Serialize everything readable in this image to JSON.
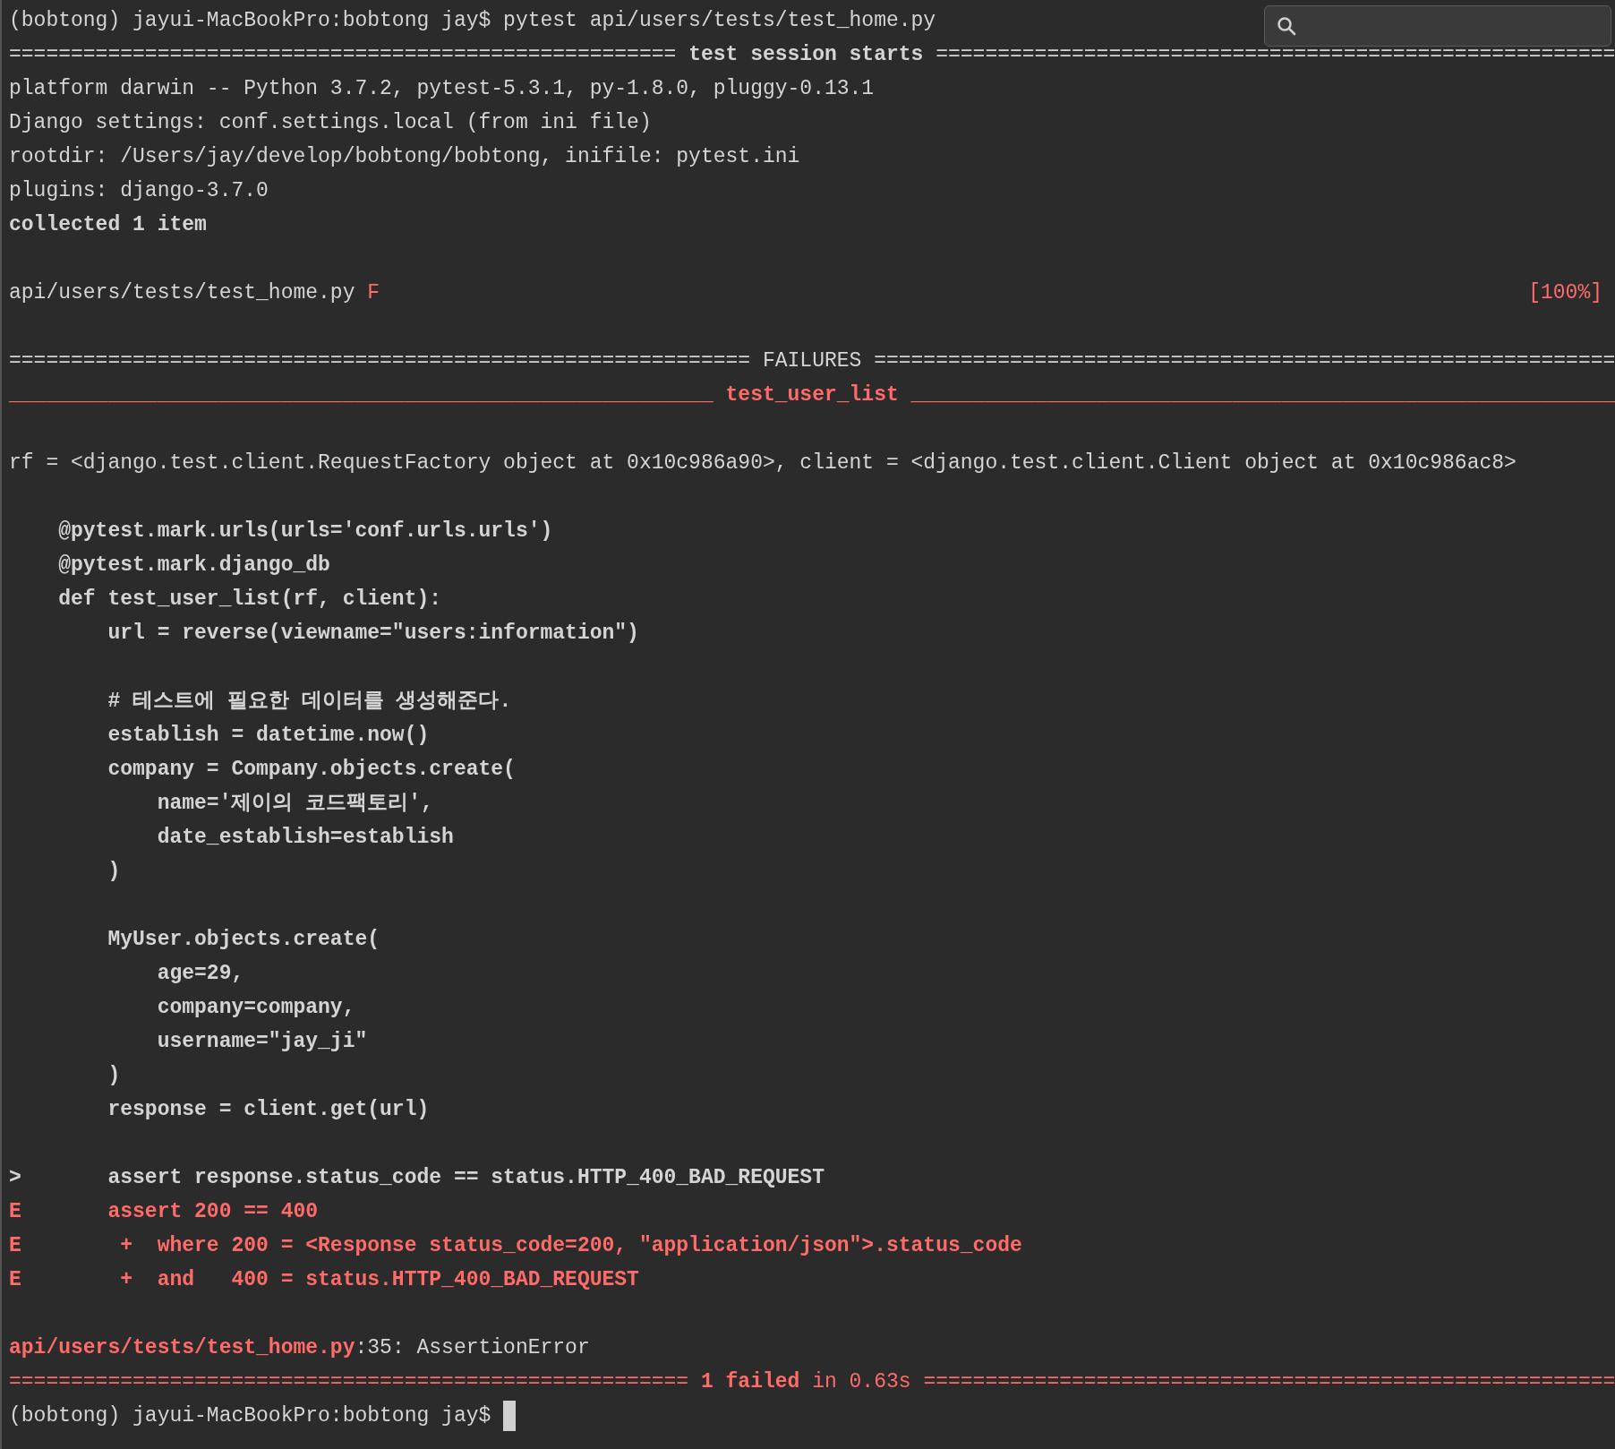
{
  "terminal": {
    "lines": [
      {
        "kind": "text",
        "segments": [
          {
            "text": "(bobtong) jayui-MacBookPro:bobtong jay$ pytest api/users/tests/test_home.py",
            "kind": "plain"
          }
        ]
      },
      {
        "kind": "text",
        "segments": [
          {
            "text": "====================================================== ",
            "kind": "plain"
          },
          {
            "text": "test session starts",
            "kind": "bold"
          },
          {
            "text": " =======================================================",
            "kind": "plain"
          }
        ]
      },
      {
        "kind": "text",
        "segments": [
          {
            "text": "platform darwin -- Python 3.7.2, pytest-5.3.1, py-1.8.0, pluggy-0.13.1",
            "kind": "plain"
          }
        ]
      },
      {
        "kind": "text",
        "segments": [
          {
            "text": "Django settings: conf.settings.local (from ini file)",
            "kind": "plain"
          }
        ]
      },
      {
        "kind": "text",
        "segments": [
          {
            "text": "rootdir: /Users/jay/develop/bobtong/bobtong, inifile: pytest.ini",
            "kind": "plain"
          }
        ]
      },
      {
        "kind": "text",
        "segments": [
          {
            "text": "plugins: django-3.7.0",
            "kind": "plain"
          }
        ]
      },
      {
        "kind": "text",
        "segments": [
          {
            "text": "collected 1 item",
            "kind": "bold"
          }
        ]
      },
      {
        "kind": "blank"
      },
      {
        "kind": "text",
        "segments": [
          {
            "text": "api/users/tests/test_home.py ",
            "kind": "plain"
          },
          {
            "text": "F",
            "kind": "red"
          }
        ],
        "right": {
          "text": "[100%]",
          "kind": "red"
        }
      },
      {
        "kind": "blank"
      },
      {
        "kind": "text",
        "segments": [
          {
            "text": "============================================================ FAILURES ============================================================",
            "kind": "plain"
          }
        ]
      },
      {
        "kind": "text",
        "segments": [
          {
            "text": "_________________________________________________________ ",
            "kind": "red"
          },
          {
            "text": "test_user_list",
            "kind": "red_bold"
          },
          {
            "text": " _________________________________________________________",
            "kind": "red"
          }
        ]
      },
      {
        "kind": "blank"
      },
      {
        "kind": "text",
        "segments": [
          {
            "text": "rf = <django.test.client.RequestFactory object at 0x10c986a90>, client = <django.test.client.Client object at 0x10c986ac8>",
            "kind": "plain"
          }
        ]
      },
      {
        "kind": "blank"
      },
      {
        "kind": "text",
        "segments": [
          {
            "text": "    @pytest.mark.urls(urls='conf.urls.urls')",
            "kind": "bold"
          }
        ]
      },
      {
        "kind": "text",
        "segments": [
          {
            "text": "    @pytest.mark.django_db",
            "kind": "bold"
          }
        ]
      },
      {
        "kind": "text",
        "segments": [
          {
            "text": "    def test_user_list(rf, client):",
            "kind": "bold"
          }
        ]
      },
      {
        "kind": "text",
        "segments": [
          {
            "text": "        url = reverse(viewname=\"users:information\")",
            "kind": "bold"
          }
        ]
      },
      {
        "kind": "blank"
      },
      {
        "kind": "text",
        "segments": [
          {
            "text": "        # 테스트에 필요한 데이터를 생성해준다.",
            "kind": "bold"
          }
        ]
      },
      {
        "kind": "text",
        "segments": [
          {
            "text": "        establish = datetime.now()",
            "kind": "bold"
          }
        ]
      },
      {
        "kind": "text",
        "segments": [
          {
            "text": "        company = Company.objects.create(",
            "kind": "bold"
          }
        ]
      },
      {
        "kind": "text",
        "segments": [
          {
            "text": "            name='제이의 코드팩토리',",
            "kind": "bold"
          }
        ]
      },
      {
        "kind": "text",
        "segments": [
          {
            "text": "            date_establish=establish",
            "kind": "bold"
          }
        ]
      },
      {
        "kind": "text",
        "segments": [
          {
            "text": "        )",
            "kind": "bold"
          }
        ]
      },
      {
        "kind": "blank"
      },
      {
        "kind": "text",
        "segments": [
          {
            "text": "        MyUser.objects.create(",
            "kind": "bold"
          }
        ]
      },
      {
        "kind": "text",
        "segments": [
          {
            "text": "            age=29,",
            "kind": "bold"
          }
        ]
      },
      {
        "kind": "text",
        "segments": [
          {
            "text": "            company=company,",
            "kind": "bold"
          }
        ]
      },
      {
        "kind": "text",
        "segments": [
          {
            "text": "            username=\"jay_ji\"",
            "kind": "bold"
          }
        ]
      },
      {
        "kind": "text",
        "segments": [
          {
            "text": "        )",
            "kind": "bold"
          }
        ]
      },
      {
        "kind": "text",
        "segments": [
          {
            "text": "        response = client.get(url)",
            "kind": "bold"
          }
        ]
      },
      {
        "kind": "blank"
      },
      {
        "kind": "text",
        "segments": [
          {
            "text": ">       assert response.status_code == status.HTTP_400_BAD_REQUEST",
            "kind": "bold"
          }
        ]
      },
      {
        "kind": "text",
        "segments": [
          {
            "text": "E       assert 200 == 400",
            "kind": "red_bold"
          }
        ]
      },
      {
        "kind": "text",
        "segments": [
          {
            "text": "E        +  where 200 = <Response status_code=200, \"application/json\">.status_code",
            "kind": "red_bold"
          }
        ]
      },
      {
        "kind": "text",
        "segments": [
          {
            "text": "E        +  and   400 = status.HTTP_400_BAD_REQUEST",
            "kind": "red_bold"
          }
        ]
      },
      {
        "kind": "blank"
      },
      {
        "kind": "text",
        "segments": [
          {
            "text": "api/users/tests/test_home.py",
            "kind": "red_bold"
          },
          {
            "text": ":35: AssertionError",
            "kind": "plain"
          }
        ]
      },
      {
        "kind": "text",
        "segments": [
          {
            "text": "======================================================= ",
            "kind": "red"
          },
          {
            "text": "1 failed",
            "kind": "red_bold"
          },
          {
            "text": " in 0.63s ========================================================",
            "kind": "red"
          }
        ]
      },
      {
        "kind": "text",
        "segments": [
          {
            "text": "(bobtong) jayui-MacBookPro:bobtong jay$ ",
            "kind": "plain"
          }
        ],
        "cursor": true
      }
    ]
  }
}
